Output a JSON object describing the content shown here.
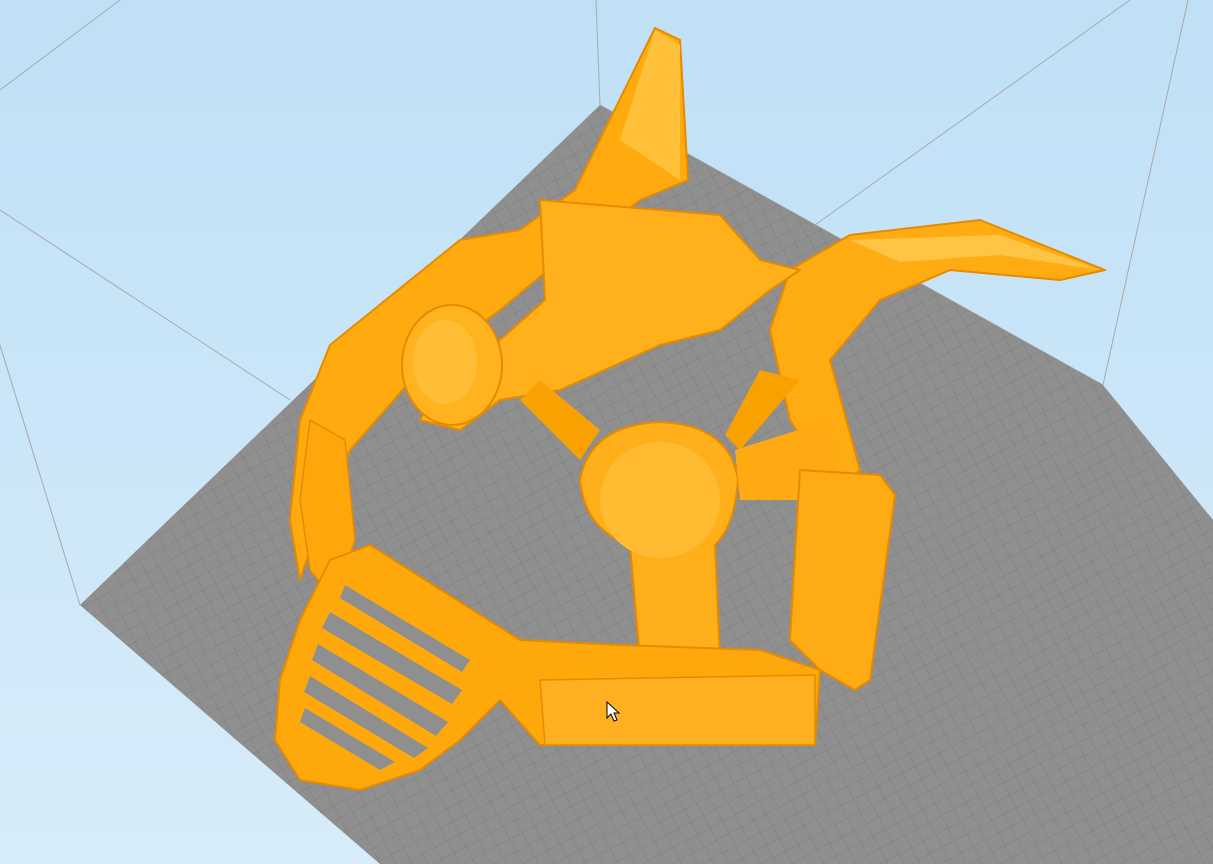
{
  "viewport": {
    "background_top": "#bfe0f6",
    "background_bottom": "#d7ecfa",
    "bed_color": "#8f8f8f",
    "grid_line_color": "#7a7a7a",
    "volume_edge_color": "#a9a9a9",
    "model_color": "#ffa800",
    "model_shadow_color": "#e88a00",
    "model_highlight_color": "#ffc040",
    "cursor_icon": "mouse-pointer-icon"
  }
}
